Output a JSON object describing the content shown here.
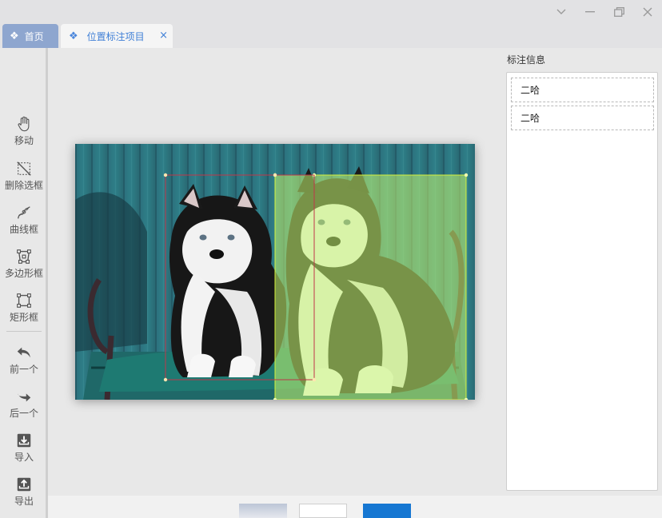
{
  "window": {
    "controls": [
      {
        "name": "chevron-down-icon",
        "glyph": "⌄"
      },
      {
        "name": "minimize-icon",
        "glyph": "—"
      },
      {
        "name": "restore-icon",
        "glyph": "❐"
      },
      {
        "name": "close-icon",
        "glyph": "✕"
      }
    ]
  },
  "tabs": {
    "home": {
      "label": "首页",
      "icon": "diamond-icon"
    },
    "active": {
      "label": "位置标注项目",
      "icon": "diamond-icon",
      "close": "×"
    }
  },
  "toolbar": {
    "move": "移动",
    "delete_box": "删除选框",
    "curve_box": "曲线框",
    "polygon_box": "多边形框",
    "rect_box": "矩形框",
    "prev": "前一个",
    "next": "后一个",
    "import": "导入",
    "export": "导出"
  },
  "panel": {
    "title": "标注信息",
    "labels": [
      "二哈",
      "二哈"
    ]
  },
  "annotations": {
    "colors": {
      "box1": "#c0374a",
      "box2": "#d7f13a",
      "fill2": "rgba(200,245,110,0.55)"
    }
  },
  "theme": {
    "accent": "#3f7fd6",
    "home_tab": "#8ea6cf",
    "thumb_blue": "#1677d2"
  }
}
